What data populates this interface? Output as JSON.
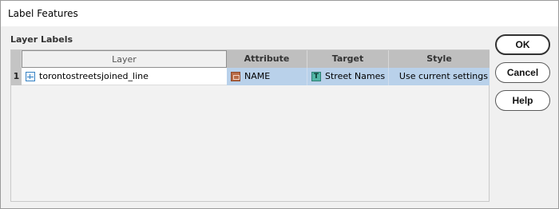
{
  "window": {
    "title": "Label Features"
  },
  "group": {
    "label": "Layer Labels"
  },
  "grid": {
    "columns": [
      "Layer",
      "Attribute",
      "Target",
      "Style"
    ],
    "rows": [
      {
        "num": "1",
        "layer": "torontostreetsjoined_line",
        "attribute": "NAME",
        "target": "Street Names",
        "style": "Use current settings"
      }
    ]
  },
  "buttons": {
    "ok": "OK",
    "cancel": "Cancel",
    "help": "Help"
  },
  "icons": {
    "layer": "line-layer-icon",
    "attribute": "attribute-icon",
    "target": "text-target-icon"
  },
  "colors": {
    "selection": "#b9d1ea",
    "header": "#bfbfbf",
    "background": "#f0f0f0"
  }
}
